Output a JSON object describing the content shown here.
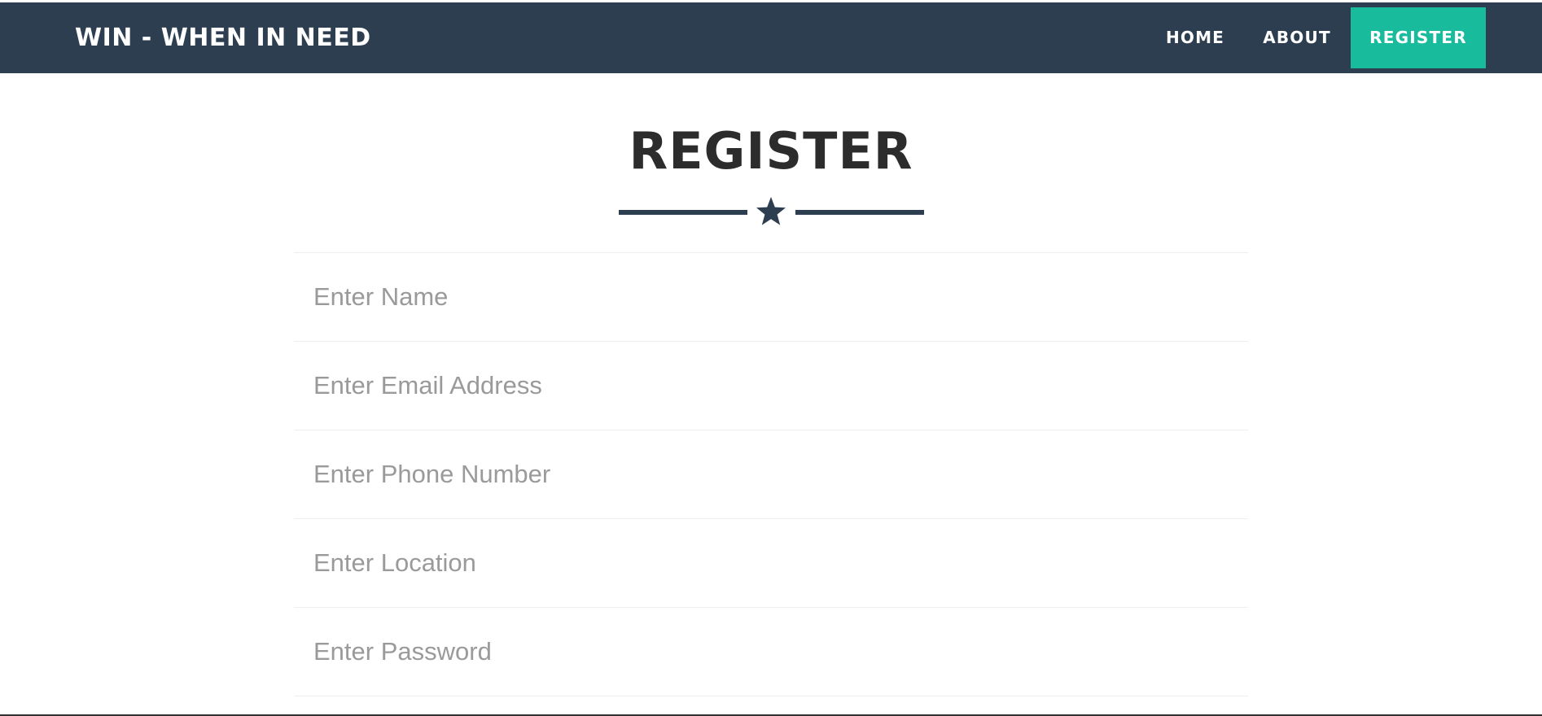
{
  "navbar": {
    "brand": "WIN - WHEN IN NEED",
    "links": [
      {
        "label": "HOME"
      },
      {
        "label": "ABOUT"
      },
      {
        "label": "REGISTER"
      }
    ],
    "background_color": "#2c3e50",
    "active_color": "#18bc9c"
  },
  "main": {
    "title": "REGISTER",
    "divider_icon": "star-icon",
    "form": {
      "fields": [
        {
          "placeholder": "Enter Name",
          "value": ""
        },
        {
          "placeholder": "Enter Email Address",
          "value": ""
        },
        {
          "placeholder": "Enter Phone Number",
          "value": ""
        },
        {
          "placeholder": "Enter Location",
          "value": ""
        },
        {
          "placeholder": "Enter Password",
          "value": ""
        }
      ]
    }
  }
}
